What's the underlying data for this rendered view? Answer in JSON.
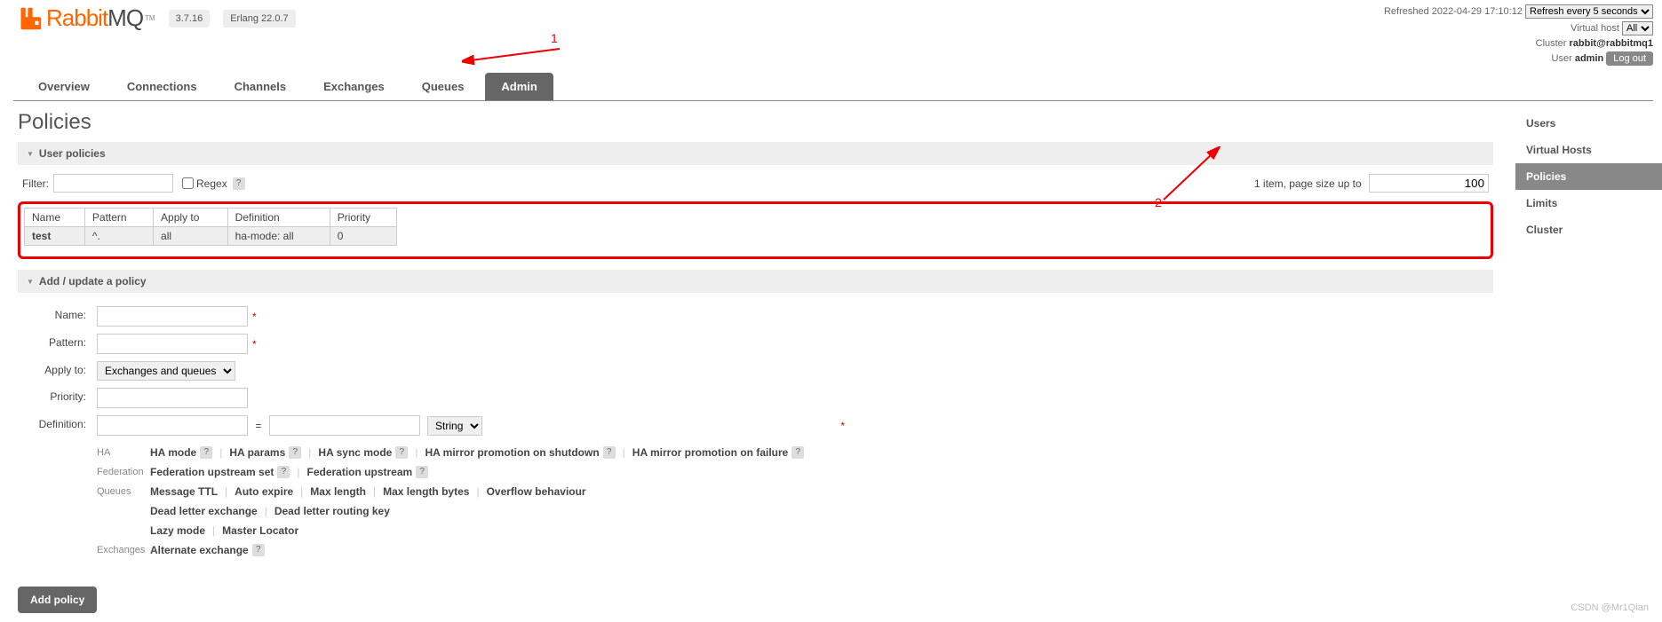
{
  "header": {
    "logo_text_primary": "Rabbit",
    "logo_text_secondary": "MQ",
    "logo_tm": "TM",
    "version": "3.7.16",
    "erlang_version": "Erlang 22.0.7",
    "refreshed_label": "Refreshed",
    "refreshed_time": "2022-04-29 17:10:12",
    "refresh_select": "Refresh every 5 seconds",
    "vhost_label": "Virtual host",
    "vhost_value": "All",
    "cluster_label": "Cluster",
    "cluster_value": "rabbit@rabbitmq1",
    "user_label": "User",
    "user_value": "admin",
    "logout": "Log out"
  },
  "tabs": [
    {
      "label": "Overview",
      "active": false
    },
    {
      "label": "Connections",
      "active": false
    },
    {
      "label": "Channels",
      "active": false
    },
    {
      "label": "Exchanges",
      "active": false
    },
    {
      "label": "Queues",
      "active": false
    },
    {
      "label": "Admin",
      "active": true
    }
  ],
  "sidebar": [
    {
      "label": "Users",
      "active": false
    },
    {
      "label": "Virtual Hosts",
      "active": false
    },
    {
      "label": "Policies",
      "active": true
    },
    {
      "label": "Limits",
      "active": false
    },
    {
      "label": "Cluster",
      "active": false
    }
  ],
  "page": {
    "title": "Policies",
    "section_user_policies": "User policies",
    "section_add_update": "Add / update a policy",
    "filter_label": "Filter:",
    "regex_label": "Regex",
    "page_info": "1 item, page size up to",
    "page_size": "100"
  },
  "policy_table": {
    "headers": [
      "Name",
      "Pattern",
      "Apply to",
      "Definition",
      "Priority"
    ],
    "rows": [
      {
        "name": "test",
        "pattern": "^.",
        "apply_to": "all",
        "definition": "ha-mode: all",
        "priority": "0"
      }
    ]
  },
  "form": {
    "name_label": "Name:",
    "pattern_label": "Pattern:",
    "apply_to_label": "Apply to:",
    "apply_to_value": "Exchanges and queues",
    "priority_label": "Priority:",
    "definition_label": "Definition:",
    "def_type": "String",
    "add_button": "Add policy"
  },
  "hints": {
    "ha": {
      "label": "HA",
      "items": [
        "HA mode",
        "HA params",
        "HA sync mode",
        "HA mirror promotion on shutdown",
        "HA mirror promotion on failure"
      ]
    },
    "federation": {
      "label": "Federation",
      "items": [
        "Federation upstream set",
        "Federation upstream"
      ]
    },
    "queues": {
      "label": "Queues",
      "rows": [
        [
          "Message TTL",
          "Auto expire",
          "Max length",
          "Max length bytes",
          "Overflow behaviour"
        ],
        [
          "Dead letter exchange",
          "Dead letter routing key"
        ],
        [
          "Lazy mode",
          "Master Locator"
        ]
      ]
    },
    "exchanges": {
      "label": "Exchanges",
      "items": [
        "Alternate exchange"
      ]
    }
  },
  "annotations": {
    "num1": "1",
    "num2": "2"
  },
  "watermark": "CSDN @Mr1Qian"
}
